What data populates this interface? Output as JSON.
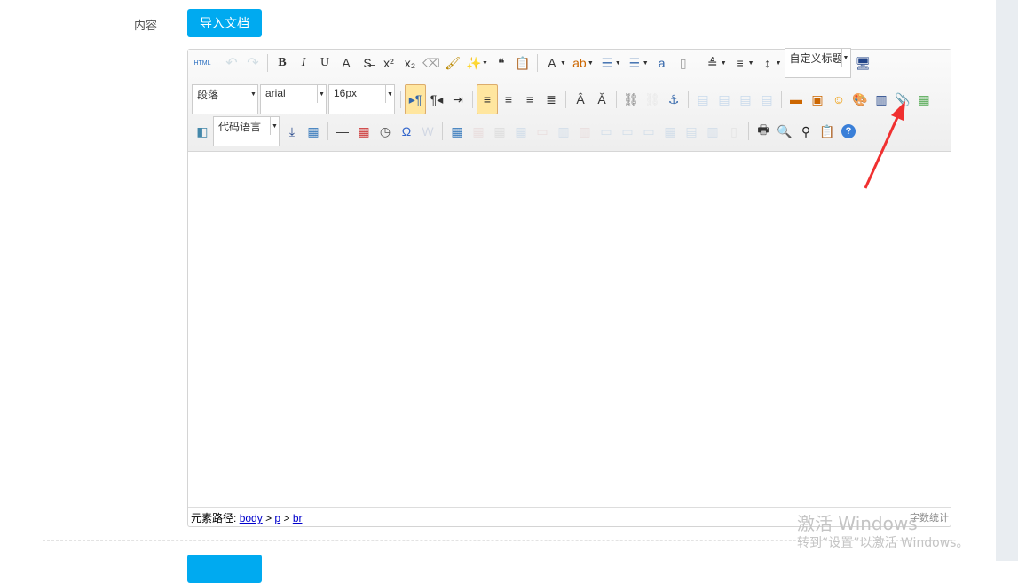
{
  "form": {
    "label": "内容",
    "import_button": "导入文档"
  },
  "editor": {
    "toolbar": {
      "row1": [
        "html-source",
        "|",
        "undo",
        "redo",
        "|",
        "bold",
        "italic",
        "underline",
        "font-border",
        "strikethrough",
        "superscript",
        "subscript",
        "eraser",
        "format-brush",
        "auto-typeset+",
        "blockquote",
        "paste-plain",
        "|",
        "font-color+",
        "background-color+",
        "ordered-list+",
        "unordered-list+",
        "select-all",
        "clear-doc",
        "|",
        "row-spacing-top+",
        "row-spacing-bottom+",
        "line-height+",
        "@custom",
        "fullscreen"
      ],
      "row2": [
        "@paragraph",
        "@fontfamily",
        "@fontsize",
        "|",
        "ltr-direction*",
        "rtl-direction",
        "indent",
        "|",
        "align-left*",
        "align-center",
        "align-right",
        "align-justify",
        "|",
        "touppercase",
        "tolowercase",
        "|",
        "link",
        "unlink",
        "anchor",
        "|",
        "image-none",
        "image-left",
        "image-right",
        "image-center",
        "|",
        "simple-upload",
        "insert-image",
        "emoticon",
        "scrawl",
        "insert-video",
        "attachment",
        "map"
      ],
      "row3": [
        "insert-frame",
        "@code",
        "page-break",
        "template",
        "|",
        "horizontal-rule",
        "date",
        "time",
        "special-chars",
        "word-image",
        "|",
        "insert-table",
        "delete-table",
        "insert-caption",
        "insert-row",
        "delete-row",
        "insert-col",
        "delete-col",
        "merge-cells",
        "merge-right",
        "merge-down",
        "split-to-cells",
        "split-to-rows",
        "split-to-cols",
        "chart",
        "|",
        "print",
        "preview",
        "search-replace",
        "draft",
        "help"
      ]
    },
    "selects": {
      "paragraph": "段落",
      "fontfamily": "arial",
      "fontsize": "16px",
      "code": "代码语言",
      "custom": "自定义标题"
    },
    "footer": {
      "path_label": "元素路径:",
      "path": [
        "body",
        "p",
        "br"
      ],
      "separator": ">",
      "word_count": "字数统计"
    }
  },
  "watermark": {
    "line1": "激活 Windows",
    "line2": "转到“设置”以激活 Windows。"
  },
  "colors": {
    "accent": "#00aaf0",
    "arrow": "#f03030"
  }
}
